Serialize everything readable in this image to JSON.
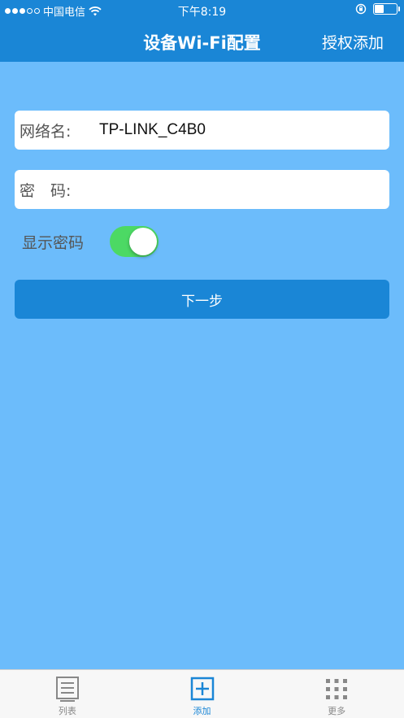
{
  "status_bar": {
    "carrier": "中国电信",
    "time": "下午8:19"
  },
  "nav": {
    "title": "设备Wi-Fi配置",
    "action_label": "授权添加"
  },
  "form": {
    "network_label": "网络名:",
    "network_value": "TP-LINK_C4B0",
    "password_label": "密　码:",
    "password_value": "",
    "show_password_label": "显示密码",
    "show_password_on": true,
    "next_label": "下一步"
  },
  "tabs": [
    {
      "label": "列表",
      "icon": "list-icon",
      "active": false
    },
    {
      "label": "添加",
      "icon": "add-icon",
      "active": true
    },
    {
      "label": "更多",
      "icon": "more-grid-icon",
      "active": false
    }
  ],
  "colors": {
    "header": "#1a86d6",
    "background": "#6cbcfb",
    "toggle_on": "#4cd964"
  }
}
